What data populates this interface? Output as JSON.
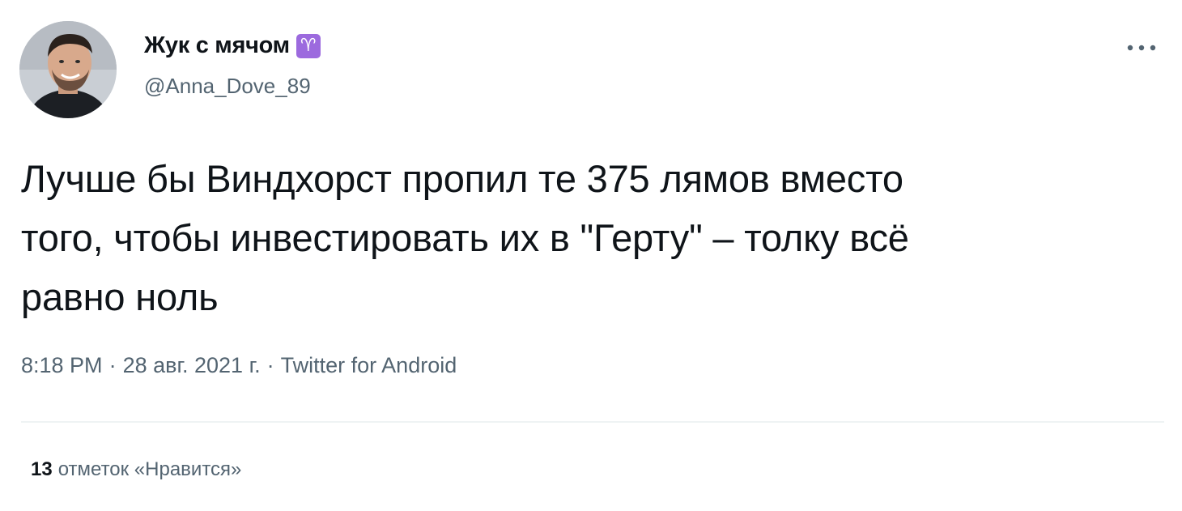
{
  "author": {
    "display_name": "Жук с мячом",
    "badge_glyph": "♈",
    "badge_color": "#9c6ade",
    "handle": "@Anna_Dove_89",
    "avatar": "avatar-photo"
  },
  "more_icon": "ellipsis-icon",
  "tweet": {
    "text": "Лучше бы Виндхорст пропил те 375 лямов вместо\nтого, чтобы инвестировать их в \"Герту\" – толку всё\nравно ноль"
  },
  "meta": {
    "time": "8:18 PM",
    "separator": "·",
    "date": "28 авг. 2021 г.",
    "source": "Twitter for Android"
  },
  "engagement": {
    "likes_count": "13",
    "likes_label": "отметок «Нравится»"
  },
  "colors": {
    "text_primary": "#0f1419",
    "text_secondary": "#536471",
    "divider": "#eff3f4"
  }
}
